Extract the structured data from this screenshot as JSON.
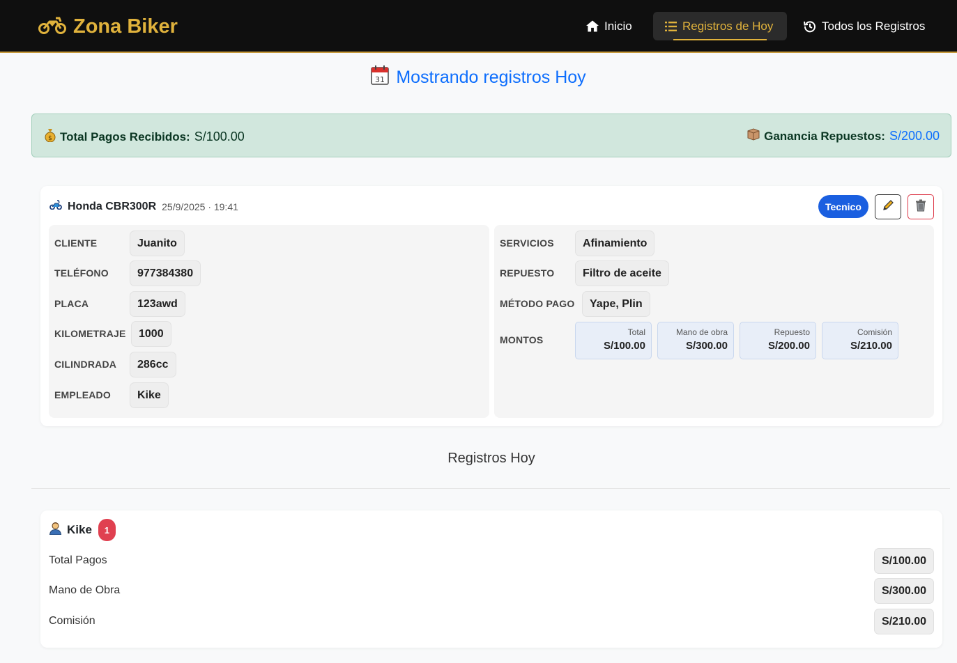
{
  "navbar": {
    "brand": "Zona Biker",
    "brand_icon": "motorcycle-icon",
    "items": [
      {
        "label": "Inicio",
        "icon": "home-icon"
      },
      {
        "label": "Registros de Hoy",
        "icon": "list-icon",
        "active": true
      },
      {
        "label": "Todos los Registros",
        "icon": "history-icon"
      }
    ],
    "colors": {
      "background": "#0f0f0f",
      "accent": "#e0b23c"
    }
  },
  "header": {
    "title": "Mostrando registros Hoy",
    "icon": "calendar-icon"
  },
  "summary": {
    "total_label": "Total Pagos Recibidos:",
    "total_value": "S/100.00",
    "ganancia_label": "Ganancia Repuestos:",
    "ganancia_value": "S/200.00"
  },
  "record": {
    "moto": "Honda CBR300R",
    "datetime": "25/9/2025 · 19:41",
    "role": "Tecnico",
    "fields_left": [
      {
        "label": "CLIENTE",
        "value": "Juanito"
      },
      {
        "label": "TELÉFONO",
        "value": "977384380"
      },
      {
        "label": "PLACA",
        "value": "123awd"
      },
      {
        "label": "KILOMETRAJE",
        "value": "1000"
      },
      {
        "label": "CILINDRADA",
        "value": "286cc"
      },
      {
        "label": "EMPLEADO",
        "value": "Kike"
      }
    ],
    "fields_right": [
      {
        "label": "SERVICIOS",
        "value": "Afinamiento"
      },
      {
        "label": "REPUESTO",
        "value": "Filtro de aceite"
      },
      {
        "label": "MÉTODO PAGO",
        "value": "Yape, Plin"
      }
    ],
    "montos_label": "MONTOS",
    "montos": [
      {
        "label": "Total",
        "value": "S/100.00"
      },
      {
        "label": "Mano de obra",
        "value": "S/300.00"
      },
      {
        "label": "Repuesto",
        "value": "S/200.00"
      },
      {
        "label": "Comisión",
        "value": "S/210.00"
      }
    ]
  },
  "section": {
    "title": "Registros Hoy"
  },
  "employee": {
    "name": "Kike",
    "count": "1",
    "rows": [
      {
        "label": "Total Pagos",
        "value": "S/100.00"
      },
      {
        "label": "Mano de Obra",
        "value": "S/300.00"
      },
      {
        "label": "Comisión",
        "value": "S/210.00"
      }
    ]
  }
}
